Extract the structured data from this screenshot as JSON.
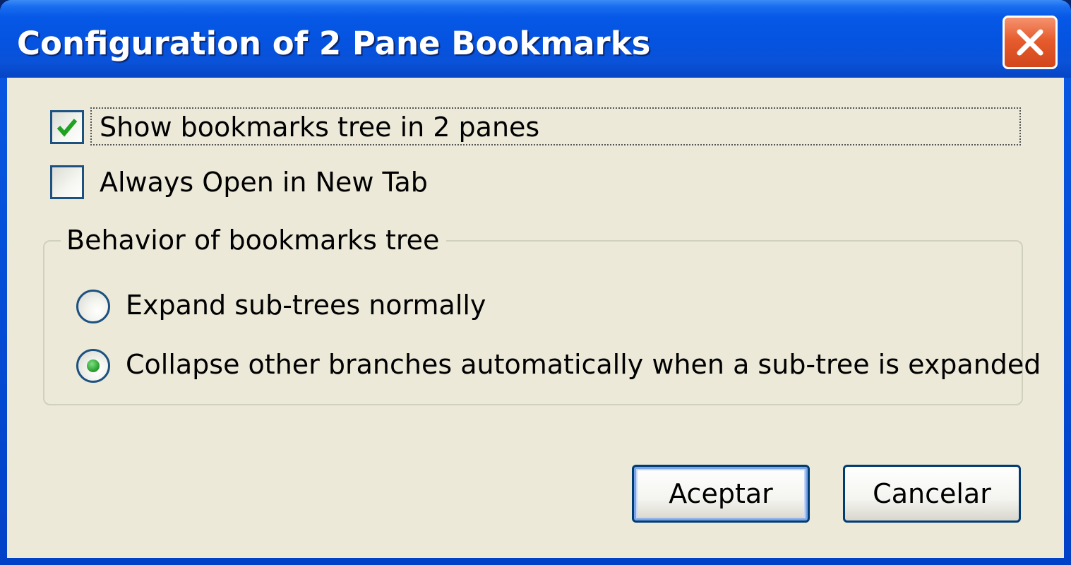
{
  "window": {
    "title": "Configuration of 2 Pane Bookmarks",
    "close_icon": "close-x-icon"
  },
  "options": {
    "show_two_panes": {
      "label": "Show bookmarks tree in 2 panes",
      "checked": true
    },
    "always_new_tab": {
      "label": "Always Open in New Tab",
      "checked": false
    }
  },
  "behavior_group": {
    "title": "Behavior of bookmarks tree",
    "radios": [
      {
        "label": "Expand sub-trees normally",
        "selected": false
      },
      {
        "label": "Collapse other branches automatically when a sub-tree is expanded",
        "selected": true
      }
    ]
  },
  "buttons": {
    "ok_label": "Aceptar",
    "cancel_label": "Cancelar"
  },
  "colors": {
    "titlebar": "#0553e0",
    "client_bg": "#ece9d8",
    "close_button": "#e65c2e",
    "check_mark": "#21a121",
    "control_border": "#1c5180"
  }
}
